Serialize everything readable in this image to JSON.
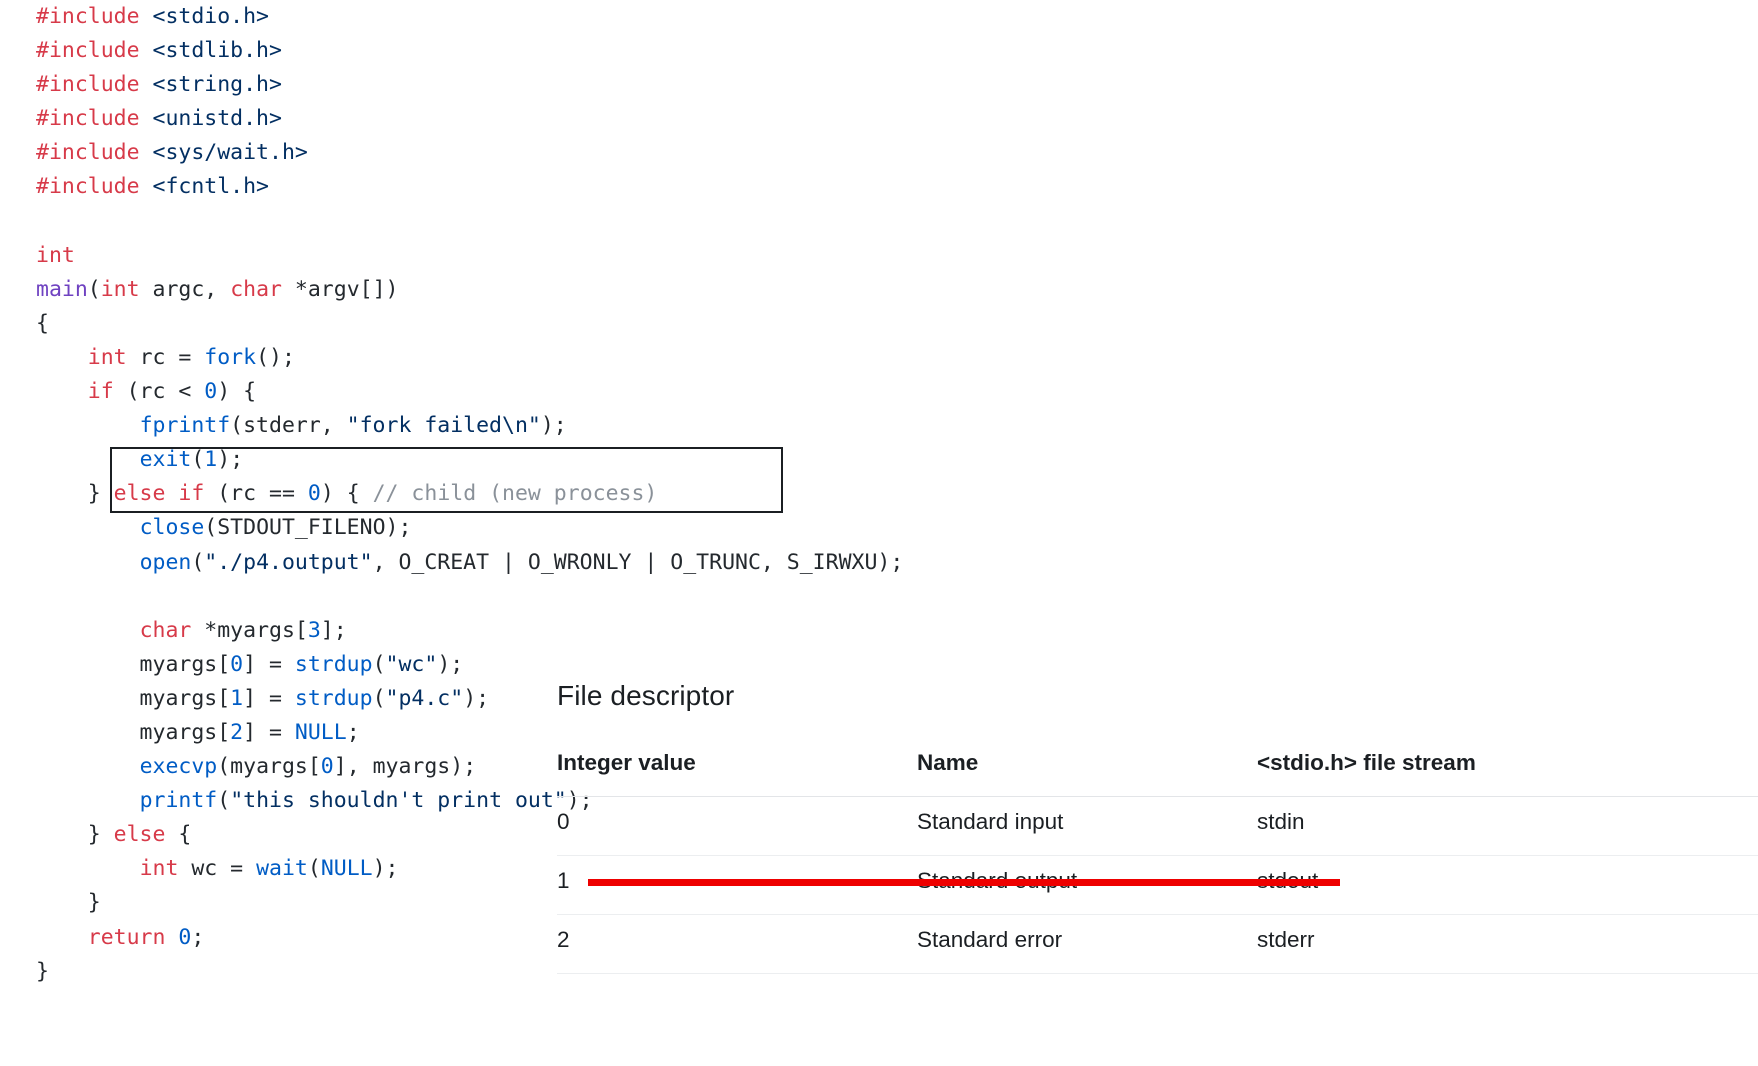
{
  "code": {
    "language": "c",
    "lines": [
      [
        {
          "t": "#include ",
          "c": "pre"
        },
        {
          "t": "<stdio.h>",
          "c": "hdr"
        }
      ],
      [
        {
          "t": "#include ",
          "c": "pre"
        },
        {
          "t": "<stdlib.h>",
          "c": "hdr"
        }
      ],
      [
        {
          "t": "#include ",
          "c": "pre"
        },
        {
          "t": "<string.h>",
          "c": "hdr"
        }
      ],
      [
        {
          "t": "#include ",
          "c": "pre"
        },
        {
          "t": "<unistd.h>",
          "c": "hdr"
        }
      ],
      [
        {
          "t": "#include ",
          "c": "pre"
        },
        {
          "t": "<sys/wait.h>",
          "c": "hdr"
        }
      ],
      [
        {
          "t": "#include ",
          "c": "pre"
        },
        {
          "t": "<fcntl.h>",
          "c": "hdr"
        }
      ],
      [],
      [
        {
          "t": "int",
          "c": "kw"
        }
      ],
      [
        {
          "t": "main",
          "c": "main"
        },
        {
          "t": "(",
          "c": "plain"
        },
        {
          "t": "int",
          "c": "kw"
        },
        {
          "t": " argc, ",
          "c": "plain"
        },
        {
          "t": "char",
          "c": "kw"
        },
        {
          "t": " *argv[])",
          "c": "plain"
        }
      ],
      [
        {
          "t": "{",
          "c": "plain"
        }
      ],
      [
        {
          "t": "    ",
          "c": "plain"
        },
        {
          "t": "int",
          "c": "kw"
        },
        {
          "t": " rc = ",
          "c": "plain"
        },
        {
          "t": "fork",
          "c": "fn"
        },
        {
          "t": "();",
          "c": "plain"
        }
      ],
      [
        {
          "t": "    ",
          "c": "plain"
        },
        {
          "t": "if",
          "c": "kw"
        },
        {
          "t": " (rc < ",
          "c": "plain"
        },
        {
          "t": "0",
          "c": "num"
        },
        {
          "t": ") {",
          "c": "plain"
        }
      ],
      [
        {
          "t": "        ",
          "c": "plain"
        },
        {
          "t": "fprintf",
          "c": "fn"
        },
        {
          "t": "(stderr, ",
          "c": "plain"
        },
        {
          "t": "\"fork failed\\n\"",
          "c": "str"
        },
        {
          "t": ");",
          "c": "plain"
        }
      ],
      [
        {
          "t": "        ",
          "c": "plain"
        },
        {
          "t": "exit",
          "c": "fn"
        },
        {
          "t": "(",
          "c": "plain"
        },
        {
          "t": "1",
          "c": "num"
        },
        {
          "t": ");",
          "c": "plain"
        }
      ],
      [
        {
          "t": "    } ",
          "c": "plain"
        },
        {
          "t": "else",
          "c": "kw"
        },
        {
          "t": " ",
          "c": "plain"
        },
        {
          "t": "if",
          "c": "kw"
        },
        {
          "t": " (rc == ",
          "c": "plain"
        },
        {
          "t": "0",
          "c": "num"
        },
        {
          "t": ") { ",
          "c": "plain"
        },
        {
          "t": "// child (new process)",
          "c": "cmt"
        }
      ],
      [
        {
          "t": "        ",
          "c": "plain"
        },
        {
          "t": "close",
          "c": "fn"
        },
        {
          "t": "(STDOUT_FILENO);",
          "c": "plain"
        }
      ],
      [
        {
          "t": "        ",
          "c": "plain"
        },
        {
          "t": "open",
          "c": "fn"
        },
        {
          "t": "(",
          "c": "plain"
        },
        {
          "t": "\"./p4.output\"",
          "c": "str"
        },
        {
          "t": ", O_CREAT | O_WRONLY | O_TRUNC, S_IRWXU);",
          "c": "plain"
        }
      ],
      [],
      [
        {
          "t": "        ",
          "c": "plain"
        },
        {
          "t": "char",
          "c": "kw"
        },
        {
          "t": " *myargs[",
          "c": "plain"
        },
        {
          "t": "3",
          "c": "num"
        },
        {
          "t": "];",
          "c": "plain"
        }
      ],
      [
        {
          "t": "        myargs[",
          "c": "plain"
        },
        {
          "t": "0",
          "c": "num"
        },
        {
          "t": "] = ",
          "c": "plain"
        },
        {
          "t": "strdup",
          "c": "fn"
        },
        {
          "t": "(",
          "c": "plain"
        },
        {
          "t": "\"wc\"",
          "c": "str"
        },
        {
          "t": ");",
          "c": "plain"
        }
      ],
      [
        {
          "t": "        myargs[",
          "c": "plain"
        },
        {
          "t": "1",
          "c": "num"
        },
        {
          "t": "] = ",
          "c": "plain"
        },
        {
          "t": "strdup",
          "c": "fn"
        },
        {
          "t": "(",
          "c": "plain"
        },
        {
          "t": "\"p4.c\"",
          "c": "str"
        },
        {
          "t": ");",
          "c": "plain"
        }
      ],
      [
        {
          "t": "        myargs[",
          "c": "plain"
        },
        {
          "t": "2",
          "c": "num"
        },
        {
          "t": "] = ",
          "c": "plain"
        },
        {
          "t": "NULL",
          "c": "const"
        },
        {
          "t": ";",
          "c": "plain"
        }
      ],
      [
        {
          "t": "        ",
          "c": "plain"
        },
        {
          "t": "execvp",
          "c": "fn"
        },
        {
          "t": "(myargs[",
          "c": "plain"
        },
        {
          "t": "0",
          "c": "num"
        },
        {
          "t": "], myargs);",
          "c": "plain"
        }
      ],
      [
        {
          "t": "        ",
          "c": "plain"
        },
        {
          "t": "printf",
          "c": "fn"
        },
        {
          "t": "(",
          "c": "plain"
        },
        {
          "t": "\"this shouldn't print out\"",
          "c": "str"
        },
        {
          "t": ");",
          "c": "plain"
        }
      ],
      [
        {
          "t": "    } ",
          "c": "plain"
        },
        {
          "t": "else",
          "c": "kw"
        },
        {
          "t": " {",
          "c": "plain"
        }
      ],
      [
        {
          "t": "        ",
          "c": "plain"
        },
        {
          "t": "int",
          "c": "kw"
        },
        {
          "t": " wc = ",
          "c": "plain"
        },
        {
          "t": "wait",
          "c": "fn"
        },
        {
          "t": "(",
          "c": "plain"
        },
        {
          "t": "NULL",
          "c": "const"
        },
        {
          "t": ");",
          "c": "plain"
        }
      ],
      [
        {
          "t": "    }",
          "c": "plain"
        }
      ],
      [
        {
          "t": "    ",
          "c": "plain"
        },
        {
          "t": "return",
          "c": "kw"
        },
        {
          "t": " ",
          "c": "plain"
        },
        {
          "t": "0",
          "c": "num"
        },
        {
          "t": ";",
          "c": "plain"
        }
      ],
      [
        {
          "t": "}",
          "c": "plain"
        }
      ]
    ],
    "highlight_box": {
      "lines": [
        "close(STDOUT_FILENO);",
        "open(\"./p4.output\", O_CREAT | O_WRONLY | O_TRUNC, S_IRWXU);"
      ],
      "border_color": "#1b1f23"
    }
  },
  "file_descriptor_panel": {
    "heading": "File descriptor",
    "columns": [
      "Integer value",
      "Name",
      "<stdio.h> file stream"
    ],
    "rows": [
      {
        "integer_value": "0",
        "name": "Standard input",
        "stream": "stdin",
        "stream_bold": true
      },
      {
        "integer_value": "1",
        "name": "Standard output",
        "stream": "stdout",
        "stream_bold": true
      },
      {
        "integer_value": "2",
        "name": "Standard error",
        "stream": "stderr",
        "stream_bold": false
      }
    ],
    "annotation": {
      "type": "underline",
      "target_row": "1",
      "color": "#ee0000"
    }
  },
  "colors": {
    "background": "#ffffff",
    "text": "#1b1f23",
    "keyword": "#d73a49",
    "function": "#005cc5",
    "string": "#032f62",
    "comment": "#8a9199",
    "main_symbol": "#6f42c1",
    "annotation_red": "#ee0000"
  }
}
